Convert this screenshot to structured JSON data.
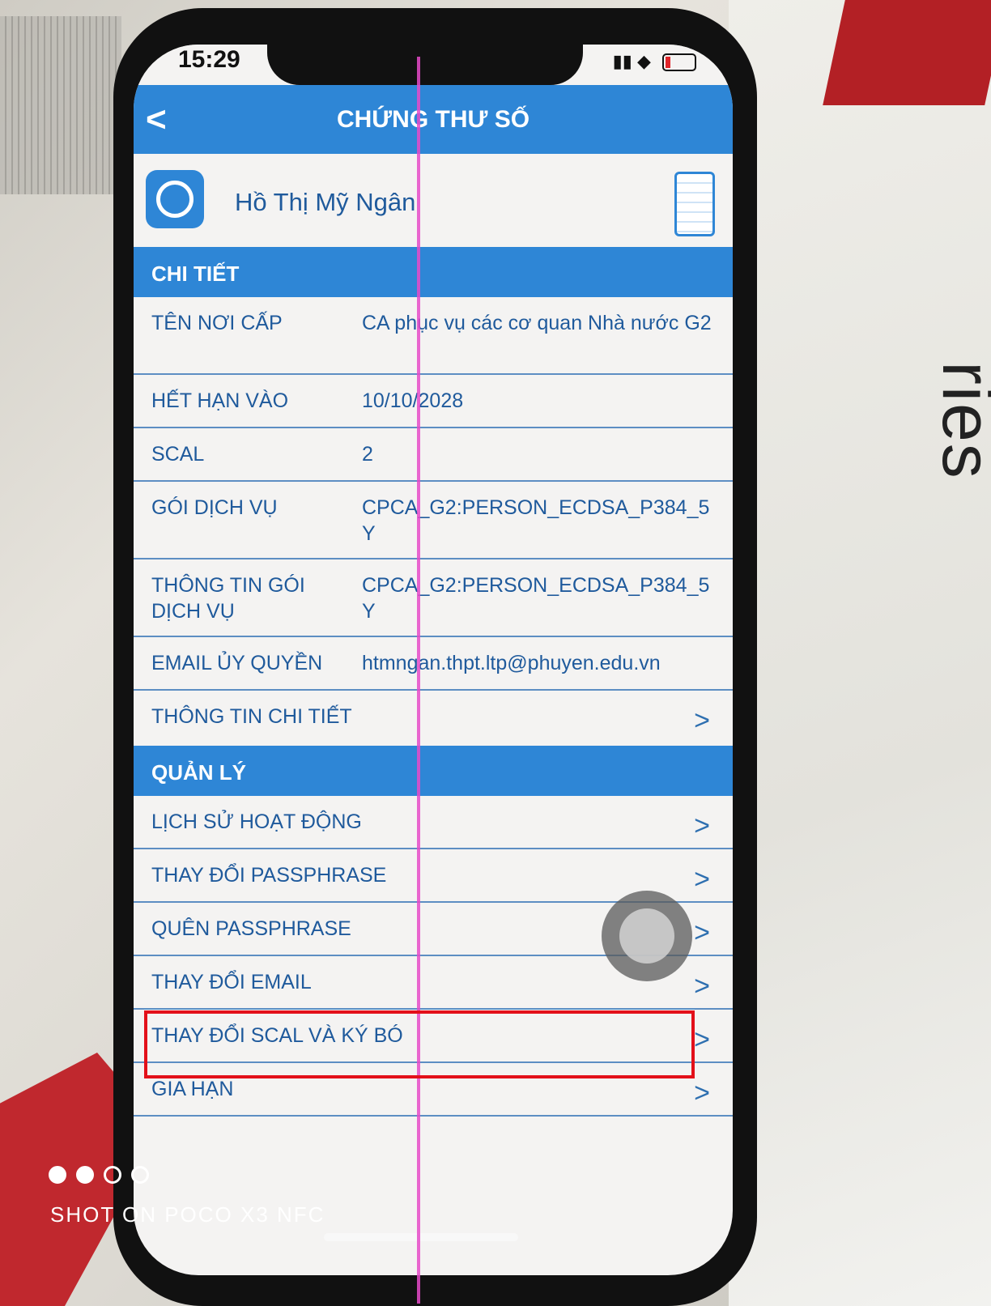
{
  "status": {
    "time": "15:29"
  },
  "nav": {
    "back": "<",
    "title": "CHỨNG THƯ SỐ"
  },
  "profile": {
    "name": "Hồ Thị Mỹ Ngân"
  },
  "sections": {
    "details": "CHI TIẾT",
    "manage": "QUẢN LÝ"
  },
  "details": [
    {
      "label": "TÊN NƠI CẤP",
      "value": "CA phục vụ các cơ quan Nhà nước G2"
    },
    {
      "label": "HẾT HẠN VÀO",
      "value": "10/10/2028"
    },
    {
      "label": "SCAL",
      "value": "2"
    },
    {
      "label": "GÓI DỊCH VỤ",
      "value": "CPCA_G2:PERSON_ECDSA_P384_5Y"
    },
    {
      "label": "THÔNG TIN GÓI DỊCH VỤ",
      "value": "CPCA_G2:PERSON_ECDSA_P384_5Y"
    },
    {
      "label": "EMAIL ỦY QUYỀN",
      "value": "htmngan.thpt.ltp@phuyen.edu.vn"
    },
    {
      "label": "THÔNG TIN CHI TIẾT",
      "chevron": ">"
    }
  ],
  "manage": [
    {
      "label": "LỊCH SỬ HOẠT ĐỘNG",
      "chevron": ">"
    },
    {
      "label": "THAY ĐỔI PASSPHRASE",
      "chevron": ">"
    },
    {
      "label": "QUÊN PASSPHRASE",
      "chevron": ">"
    },
    {
      "label": "THAY ĐỔI EMAIL",
      "chevron": ">"
    },
    {
      "label": "THAY ĐỔI SCAL VÀ KÝ BÓ",
      "chevron": ">"
    },
    {
      "label": "GIA HẠN",
      "chevron": ">"
    }
  ],
  "photo": {
    "watermark": "SHOT ON POCO X3 NFC",
    "box_text": "ries"
  }
}
